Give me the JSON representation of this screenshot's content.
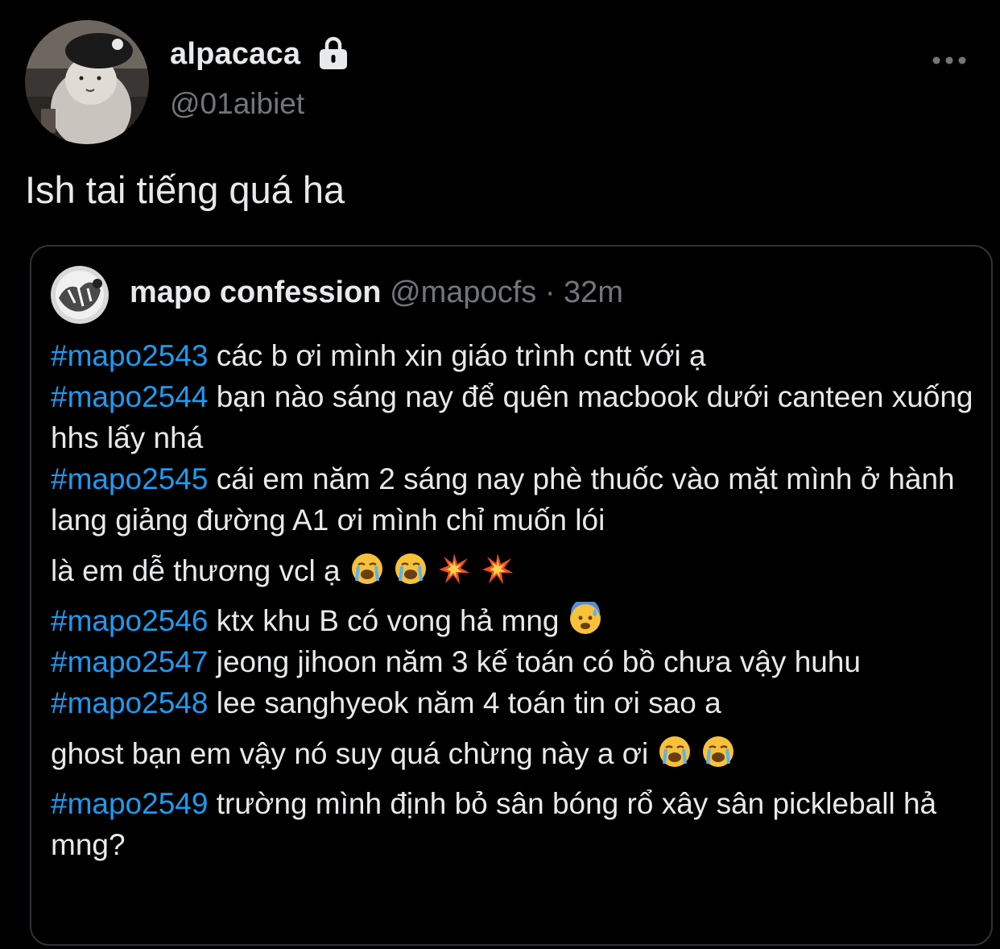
{
  "author": {
    "display_name": "alpacaca",
    "handle": "@01aibiet",
    "protected_icon": "lock-icon",
    "avatar_icon": "alpaca-plush-avatar"
  },
  "tweet": {
    "text": "Ish tai tiếng quá ha"
  },
  "more_icon": "ellipsis-icon",
  "quote": {
    "display_name": "mapo confession",
    "handle": "@mapocfs",
    "separator": "·",
    "time": "32m",
    "avatar_icon": "mapo-logo-avatar",
    "posts": [
      {
        "tag": "#mapo2543",
        "text": " các b ơi mình xin giáo trình cntt với ạ",
        "emojis": []
      },
      {
        "tag": "#mapo2544",
        "text": " bạn nào sáng nay để quên macbook dưới canteen xuống hhs lấy nhá",
        "emojis": []
      },
      {
        "tag": "#mapo2545",
        "text": " cái em năm 2 sáng nay phè thuốc vào mặt mình ở hành lang giảng đường A1 ơi mình chỉ muốn lói",
        "line2": "là em dễ thương vcl ạ",
        "emojis": [
          "loudly-crying-face",
          "loudly-crying-face",
          "collision",
          "collision"
        ]
      },
      {
        "tag": "#mapo2546",
        "text": " ktx khu B có vong hả mng",
        "emojis": [
          "anxious-face-with-sweat"
        ]
      },
      {
        "tag": "#mapo2547",
        "text": " jeong jihoon năm 3 kế toán có bồ chưa vậy huhu",
        "emojis": []
      },
      {
        "tag": "#mapo2548",
        "text": " lee sanghyeok năm 4 toán tin ơi sao a",
        "line2": "ghost bạn em vậy nó suy quá chừng này a ơi",
        "emojis": [
          "loudly-crying-face",
          "loudly-crying-face"
        ]
      },
      {
        "tag": "#mapo2549",
        "text": " trường mình định bỏ sân bóng rổ xây sân pickleball hả mng?",
        "emojis": []
      }
    ]
  },
  "colors": {
    "background": "#000000",
    "text": "#e7e9ea",
    "secondary": "#71767b",
    "link": "#1d9bf0",
    "border": "#2f3336"
  }
}
